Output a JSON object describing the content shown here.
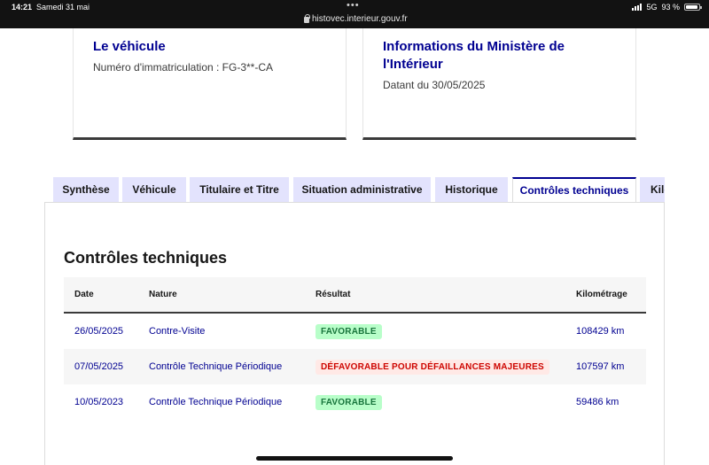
{
  "status_bar": {
    "time": "14:21",
    "date": "Samedi 31 mai",
    "url": "histovec.interieur.gouv.fr",
    "network": "5G",
    "battery": "93 %",
    "battery_level": 0.93
  },
  "cards": [
    {
      "title": "Le véhicule",
      "desc": "Numéro d'immatriculation : FG-3**-CA"
    },
    {
      "title": "Informations du Ministère de l'Intérieur",
      "desc": "Datant du 30/05/2025"
    }
  ],
  "tabs": [
    {
      "label": "Synthèse",
      "active": false
    },
    {
      "label": "Véhicule",
      "active": false
    },
    {
      "label": "Titulaire et Titre",
      "active": false
    },
    {
      "label": "Situation administrative",
      "active": false
    },
    {
      "label": "Historique",
      "active": false
    },
    {
      "label": "Contrôles techniques",
      "active": true
    },
    {
      "label": "Kilométrage",
      "active": false
    }
  ],
  "panel": {
    "title": "Contrôles techniques",
    "columns": [
      "Date",
      "Nature",
      "Résultat",
      "Kilométrage"
    ],
    "rows": [
      {
        "date": "26/05/2025",
        "nature": "Contre-Visite",
        "result": "FAVORABLE",
        "km": "108429 km"
      },
      {
        "date": "07/05/2025",
        "nature": "Contrôle Technique Périodique",
        "result": "DÉFAVORABLE POUR DÉFAILLANCES MAJEURES",
        "km": "107597 km"
      },
      {
        "date": "10/05/2023",
        "nature": "Contrôle Technique Périodique",
        "result": "FAVORABLE",
        "km": "59486 km"
      }
    ]
  },
  "colors": {
    "primary": "#000091",
    "tab_bg": "#e3e3fd",
    "success_bg": "#b8fec9",
    "success_text": "#18753c",
    "error_bg": "#ffe9e6",
    "error_text": "#ce0500"
  }
}
